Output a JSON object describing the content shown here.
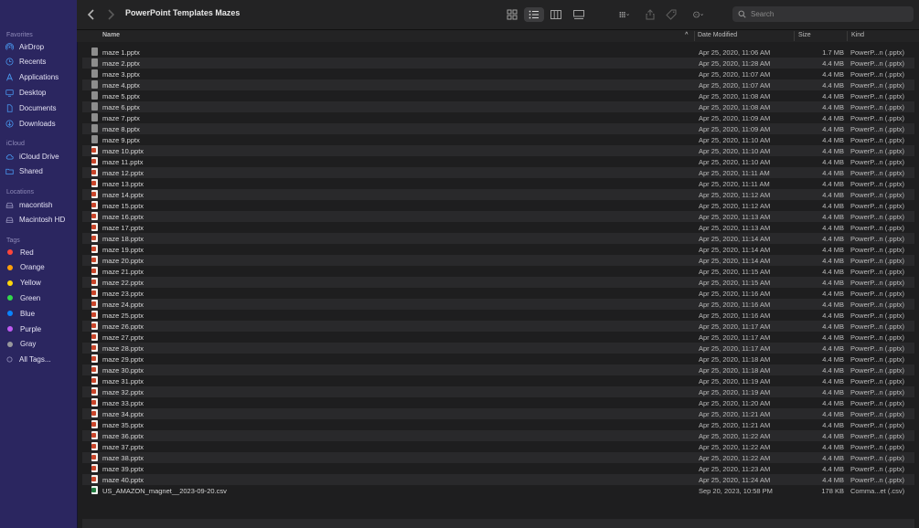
{
  "window": {
    "title": "PowerPoint Templates Mazes"
  },
  "search": {
    "placeholder": "Search"
  },
  "sidebar": {
    "favorites_label": "Favorites",
    "favorites": [
      {
        "label": "AirDrop",
        "icon": "airdrop-icon"
      },
      {
        "label": "Recents",
        "icon": "clock-icon"
      },
      {
        "label": "Applications",
        "icon": "applications-icon"
      },
      {
        "label": "Desktop",
        "icon": "desktop-icon"
      },
      {
        "label": "Documents",
        "icon": "document-icon"
      },
      {
        "label": "Downloads",
        "icon": "download-icon"
      }
    ],
    "icloud_label": "iCloud",
    "icloud": [
      {
        "label": "iCloud Drive",
        "icon": "cloud-icon"
      },
      {
        "label": "Shared",
        "icon": "shared-folder-icon"
      }
    ],
    "locations_label": "Locations",
    "locations": [
      {
        "label": "macontish",
        "icon": "disk-icon"
      },
      {
        "label": "Macintosh HD",
        "icon": "disk-icon"
      }
    ],
    "tags_label": "Tags",
    "tags": [
      {
        "label": "Red",
        "color": "#ff453a"
      },
      {
        "label": "Orange",
        "color": "#ff9f0a"
      },
      {
        "label": "Yellow",
        "color": "#ffd60a"
      },
      {
        "label": "Green",
        "color": "#32d74b"
      },
      {
        "label": "Blue",
        "color": "#0a84ff"
      },
      {
        "label": "Purple",
        "color": "#bf5af2"
      },
      {
        "label": "Gray",
        "color": "#98989d"
      }
    ],
    "all_tags": "All Tags..."
  },
  "columns": {
    "name": "Name",
    "date": "Date Modified",
    "size": "Size",
    "kind": "Kind"
  },
  "files": [
    {
      "name": "maze 1.pptx",
      "date": "Apr 25, 2020, 11:06 AM",
      "size": "1.7 MB",
      "kind": "PowerP...n (.pptx)",
      "icon": "gray"
    },
    {
      "name": "maze 2.pptx",
      "date": "Apr 25, 2020, 11:28 AM",
      "size": "4.4 MB",
      "kind": "PowerP...n (.pptx)",
      "icon": "gray"
    },
    {
      "name": "maze 3.pptx",
      "date": "Apr 25, 2020, 11:07 AM",
      "size": "4.4 MB",
      "kind": "PowerP...n (.pptx)",
      "icon": "gray"
    },
    {
      "name": "maze 4.pptx",
      "date": "Apr 25, 2020, 11:07 AM",
      "size": "4.4 MB",
      "kind": "PowerP...n (.pptx)",
      "icon": "gray"
    },
    {
      "name": "maze 5.pptx",
      "date": "Apr 25, 2020, 11:08 AM",
      "size": "4.4 MB",
      "kind": "PowerP...n (.pptx)",
      "icon": "gray"
    },
    {
      "name": "maze 6.pptx",
      "date": "Apr 25, 2020, 11:08 AM",
      "size": "4.4 MB",
      "kind": "PowerP...n (.pptx)",
      "icon": "gray"
    },
    {
      "name": "maze 7.pptx",
      "date": "Apr 25, 2020, 11:09 AM",
      "size": "4.4 MB",
      "kind": "PowerP...n (.pptx)",
      "icon": "gray"
    },
    {
      "name": "maze 8.pptx",
      "date": "Apr 25, 2020, 11:09 AM",
      "size": "4.4 MB",
      "kind": "PowerP...n (.pptx)",
      "icon": "gray"
    },
    {
      "name": "maze 9.pptx",
      "date": "Apr 25, 2020, 11:10 AM",
      "size": "4.4 MB",
      "kind": "PowerP...n (.pptx)",
      "icon": "gray"
    },
    {
      "name": "maze 10.pptx",
      "date": "Apr 25, 2020, 11:10 AM",
      "size": "4.4 MB",
      "kind": "PowerP...n (.pptx)",
      "icon": "ppt"
    },
    {
      "name": "maze 11.pptx",
      "date": "Apr 25, 2020, 11:10 AM",
      "size": "4.4 MB",
      "kind": "PowerP...n (.pptx)",
      "icon": "ppt"
    },
    {
      "name": "maze 12.pptx",
      "date": "Apr 25, 2020, 11:11 AM",
      "size": "4.4 MB",
      "kind": "PowerP...n (.pptx)",
      "icon": "ppt"
    },
    {
      "name": "maze 13.pptx",
      "date": "Apr 25, 2020, 11:11 AM",
      "size": "4.4 MB",
      "kind": "PowerP...n (.pptx)",
      "icon": "ppt"
    },
    {
      "name": "maze 14.pptx",
      "date": "Apr 25, 2020, 11:12 AM",
      "size": "4.4 MB",
      "kind": "PowerP...n (.pptx)",
      "icon": "ppt"
    },
    {
      "name": "maze 15.pptx",
      "date": "Apr 25, 2020, 11:12 AM",
      "size": "4.4 MB",
      "kind": "PowerP...n (.pptx)",
      "icon": "ppt"
    },
    {
      "name": "maze 16.pptx",
      "date": "Apr 25, 2020, 11:13 AM",
      "size": "4.4 MB",
      "kind": "PowerP...n (.pptx)",
      "icon": "ppt"
    },
    {
      "name": "maze 17.pptx",
      "date": "Apr 25, 2020, 11:13 AM",
      "size": "4.4 MB",
      "kind": "PowerP...n (.pptx)",
      "icon": "ppt"
    },
    {
      "name": "maze 18.pptx",
      "date": "Apr 25, 2020, 11:14 AM",
      "size": "4.4 MB",
      "kind": "PowerP...n (.pptx)",
      "icon": "ppt"
    },
    {
      "name": "maze 19.pptx",
      "date": "Apr 25, 2020, 11:14 AM",
      "size": "4.4 MB",
      "kind": "PowerP...n (.pptx)",
      "icon": "ppt"
    },
    {
      "name": "maze 20.pptx",
      "date": "Apr 25, 2020, 11:14 AM",
      "size": "4.4 MB",
      "kind": "PowerP...n (.pptx)",
      "icon": "ppt"
    },
    {
      "name": "maze 21.pptx",
      "date": "Apr 25, 2020, 11:15 AM",
      "size": "4.4 MB",
      "kind": "PowerP...n (.pptx)",
      "icon": "ppt"
    },
    {
      "name": "maze 22.pptx",
      "date": "Apr 25, 2020, 11:15 AM",
      "size": "4.4 MB",
      "kind": "PowerP...n (.pptx)",
      "icon": "ppt"
    },
    {
      "name": "maze 23.pptx",
      "date": "Apr 25, 2020, 11:16 AM",
      "size": "4.4 MB",
      "kind": "PowerP...n (.pptx)",
      "icon": "ppt"
    },
    {
      "name": "maze 24.pptx",
      "date": "Apr 25, 2020, 11:16 AM",
      "size": "4.4 MB",
      "kind": "PowerP...n (.pptx)",
      "icon": "ppt"
    },
    {
      "name": "maze 25.pptx",
      "date": "Apr 25, 2020, 11:16 AM",
      "size": "4.4 MB",
      "kind": "PowerP...n (.pptx)",
      "icon": "ppt"
    },
    {
      "name": "maze 26.pptx",
      "date": "Apr 25, 2020, 11:17 AM",
      "size": "4.4 MB",
      "kind": "PowerP...n (.pptx)",
      "icon": "ppt"
    },
    {
      "name": "maze 27.pptx",
      "date": "Apr 25, 2020, 11:17 AM",
      "size": "4.4 MB",
      "kind": "PowerP...n (.pptx)",
      "icon": "ppt"
    },
    {
      "name": "maze 28.pptx",
      "date": "Apr 25, 2020, 11:17 AM",
      "size": "4.4 MB",
      "kind": "PowerP...n (.pptx)",
      "icon": "ppt"
    },
    {
      "name": "maze 29.pptx",
      "date": "Apr 25, 2020, 11:18 AM",
      "size": "4.4 MB",
      "kind": "PowerP...n (.pptx)",
      "icon": "ppt"
    },
    {
      "name": "maze 30.pptx",
      "date": "Apr 25, 2020, 11:18 AM",
      "size": "4.4 MB",
      "kind": "PowerP...n (.pptx)",
      "icon": "ppt"
    },
    {
      "name": "maze 31.pptx",
      "date": "Apr 25, 2020, 11:19 AM",
      "size": "4.4 MB",
      "kind": "PowerP...n (.pptx)",
      "icon": "ppt"
    },
    {
      "name": "maze 32.pptx",
      "date": "Apr 25, 2020, 11:19 AM",
      "size": "4.4 MB",
      "kind": "PowerP...n (.pptx)",
      "icon": "ppt"
    },
    {
      "name": "maze 33.pptx",
      "date": "Apr 25, 2020, 11:20 AM",
      "size": "4.4 MB",
      "kind": "PowerP...n (.pptx)",
      "icon": "ppt"
    },
    {
      "name": "maze 34.pptx",
      "date": "Apr 25, 2020, 11:21 AM",
      "size": "4.4 MB",
      "kind": "PowerP...n (.pptx)",
      "icon": "ppt"
    },
    {
      "name": "maze 35.pptx",
      "date": "Apr 25, 2020, 11:21 AM",
      "size": "4.4 MB",
      "kind": "PowerP...n (.pptx)",
      "icon": "ppt"
    },
    {
      "name": "maze 36.pptx",
      "date": "Apr 25, 2020, 11:22 AM",
      "size": "4.4 MB",
      "kind": "PowerP...n (.pptx)",
      "icon": "ppt"
    },
    {
      "name": "maze 37.pptx",
      "date": "Apr 25, 2020, 11:22 AM",
      "size": "4.4 MB",
      "kind": "PowerP...n (.pptx)",
      "icon": "ppt"
    },
    {
      "name": "maze 38.pptx",
      "date": "Apr 25, 2020, 11:22 AM",
      "size": "4.4 MB",
      "kind": "PowerP...n (.pptx)",
      "icon": "ppt"
    },
    {
      "name": "maze 39.pptx",
      "date": "Apr 25, 2020, 11:23 AM",
      "size": "4.4 MB",
      "kind": "PowerP...n (.pptx)",
      "icon": "ppt"
    },
    {
      "name": "maze 40.pptx",
      "date": "Apr 25, 2020, 11:24 AM",
      "size": "4.4 MB",
      "kind": "PowerP...n (.pptx)",
      "icon": "ppt"
    },
    {
      "name": "US_AMAZON_magnet__2023-09-20.csv",
      "date": "Sep 20, 2023, 10:58 PM",
      "size": "178 KB",
      "kind": "Comma...et (.csv)",
      "icon": "csv"
    }
  ]
}
